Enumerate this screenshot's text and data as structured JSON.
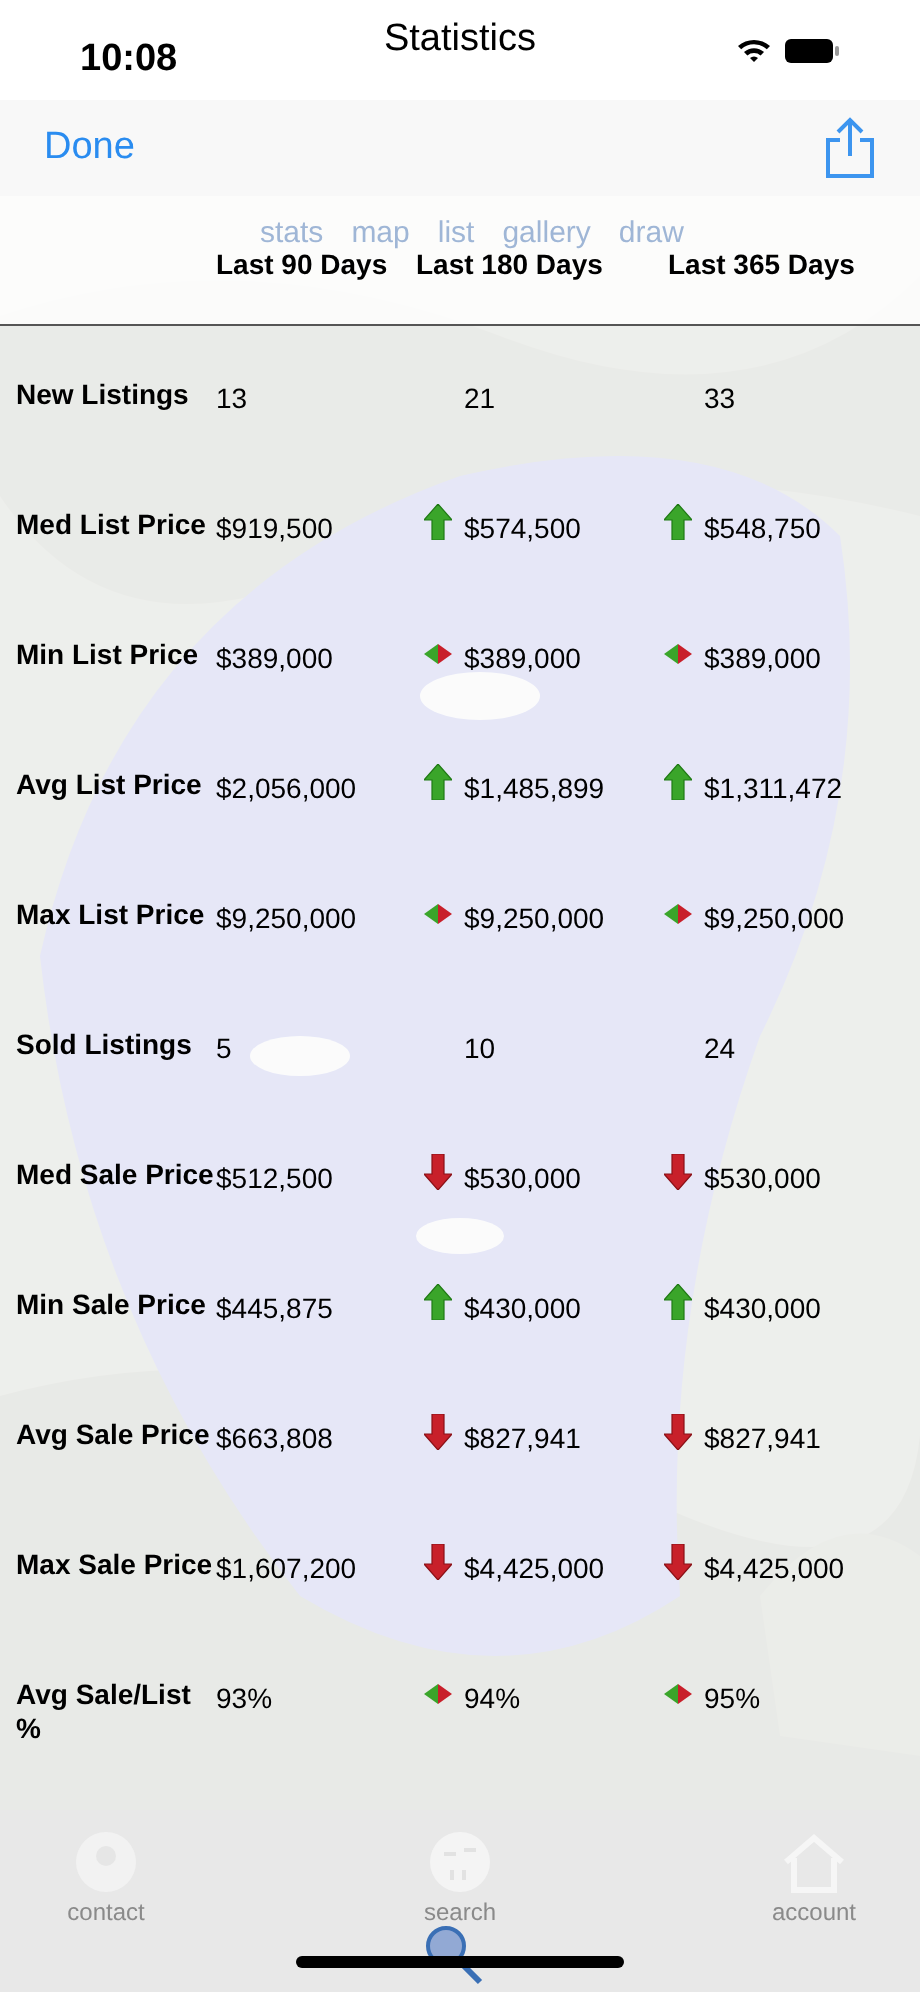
{
  "status_bar": {
    "time": "10:08"
  },
  "title": "Statistics",
  "nav": {
    "done": "Done"
  },
  "behind_tabs": [
    "stats",
    "map",
    "list",
    "gallery",
    "draw"
  ],
  "columns": [
    "Last 90 Days",
    "Last 180 Days",
    "Last 365 Days"
  ],
  "rows": [
    {
      "label": "New Listings",
      "values": [
        {
          "text": "13",
          "kind": "plain"
        },
        {
          "text": "21",
          "kind": "plain"
        },
        {
          "text": "33",
          "kind": "plain"
        }
      ]
    },
    {
      "label": "Med List Price",
      "values": [
        {
          "text": "$919,500",
          "kind": "plain"
        },
        {
          "text": "$574,500",
          "kind": "up"
        },
        {
          "text": "$548,750",
          "kind": "up"
        }
      ]
    },
    {
      "label": "Min List Price",
      "values": [
        {
          "text": "$389,000",
          "kind": "plain"
        },
        {
          "text": "$389,000",
          "kind": "same"
        },
        {
          "text": "$389,000",
          "kind": "same"
        }
      ]
    },
    {
      "label": "Avg List Price",
      "values": [
        {
          "text": "$2,056,000",
          "kind": "plain"
        },
        {
          "text": "$1,485,899",
          "kind": "up"
        },
        {
          "text": "$1,311,472",
          "kind": "up"
        }
      ]
    },
    {
      "label": "Max List Price",
      "values": [
        {
          "text": "$9,250,000",
          "kind": "plain"
        },
        {
          "text": "$9,250,000",
          "kind": "same"
        },
        {
          "text": "$9,250,000",
          "kind": "same"
        }
      ]
    },
    {
      "label": "Sold Listings",
      "values": [
        {
          "text": "5",
          "kind": "plain"
        },
        {
          "text": "10",
          "kind": "plain"
        },
        {
          "text": "24",
          "kind": "plain"
        }
      ]
    },
    {
      "label": "Med Sale Price",
      "values": [
        {
          "text": "$512,500",
          "kind": "plain"
        },
        {
          "text": "$530,000",
          "kind": "down"
        },
        {
          "text": "$530,000",
          "kind": "down"
        }
      ]
    },
    {
      "label": "Min Sale Price",
      "values": [
        {
          "text": "$445,875",
          "kind": "plain"
        },
        {
          "text": "$430,000",
          "kind": "up"
        },
        {
          "text": "$430,000",
          "kind": "up"
        }
      ]
    },
    {
      "label": "Avg Sale Price",
      "values": [
        {
          "text": "$663,808",
          "kind": "plain"
        },
        {
          "text": "$827,941",
          "kind": "down"
        },
        {
          "text": "$827,941",
          "kind": "down"
        }
      ]
    },
    {
      "label": "Max Sale Price",
      "values": [
        {
          "text": "$1,607,200",
          "kind": "plain"
        },
        {
          "text": "$4,425,000",
          "kind": "down"
        },
        {
          "text": "$4,425,000",
          "kind": "down"
        }
      ]
    },
    {
      "label": "Avg Sale/List %",
      "values": [
        {
          "text": "93%",
          "kind": "plain"
        },
        {
          "text": "94%",
          "kind": "same"
        },
        {
          "text": "95%",
          "kind": "same"
        }
      ]
    }
  ],
  "tab_bar": [
    {
      "label": "contact",
      "kind": "contact"
    },
    {
      "label": "search",
      "kind": "search"
    },
    {
      "label": "account",
      "kind": "account"
    }
  ]
}
